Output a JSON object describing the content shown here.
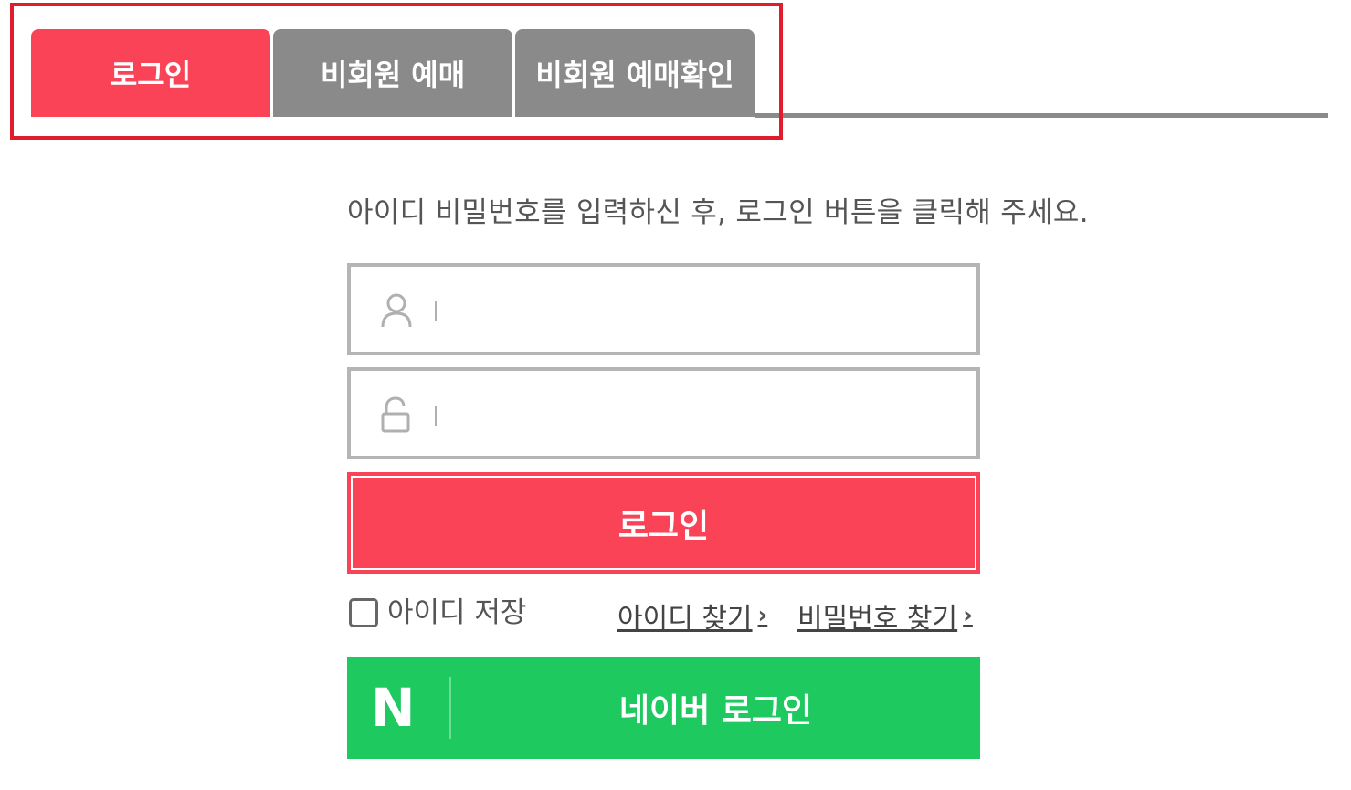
{
  "tabs": [
    {
      "label": "로그인",
      "active": true
    },
    {
      "label": "비회원 예매",
      "active": false
    },
    {
      "label": "비회원 예매확인",
      "active": false
    }
  ],
  "instruction": "아이디 비밀번호를 입력하신 후, 로그인 버튼을 클릭해 주세요.",
  "id_field": {
    "value": "",
    "icon": "user-icon"
  },
  "pw_field": {
    "value": "",
    "icon": "lock-icon"
  },
  "login_button": {
    "label": "로그인"
  },
  "save_id": {
    "label": "아이디 저장",
    "checked": false
  },
  "find_id": {
    "label": "아이디 찾기"
  },
  "find_pw": {
    "label": "비밀번호 찾기"
  },
  "naver_login": {
    "logo": "N",
    "label": "네이버 로그인"
  },
  "colors": {
    "accent": "#fb4357",
    "tab_inactive": "#8a8a8a",
    "naver": "#1ec95f",
    "highlight": "#e01e2b"
  }
}
